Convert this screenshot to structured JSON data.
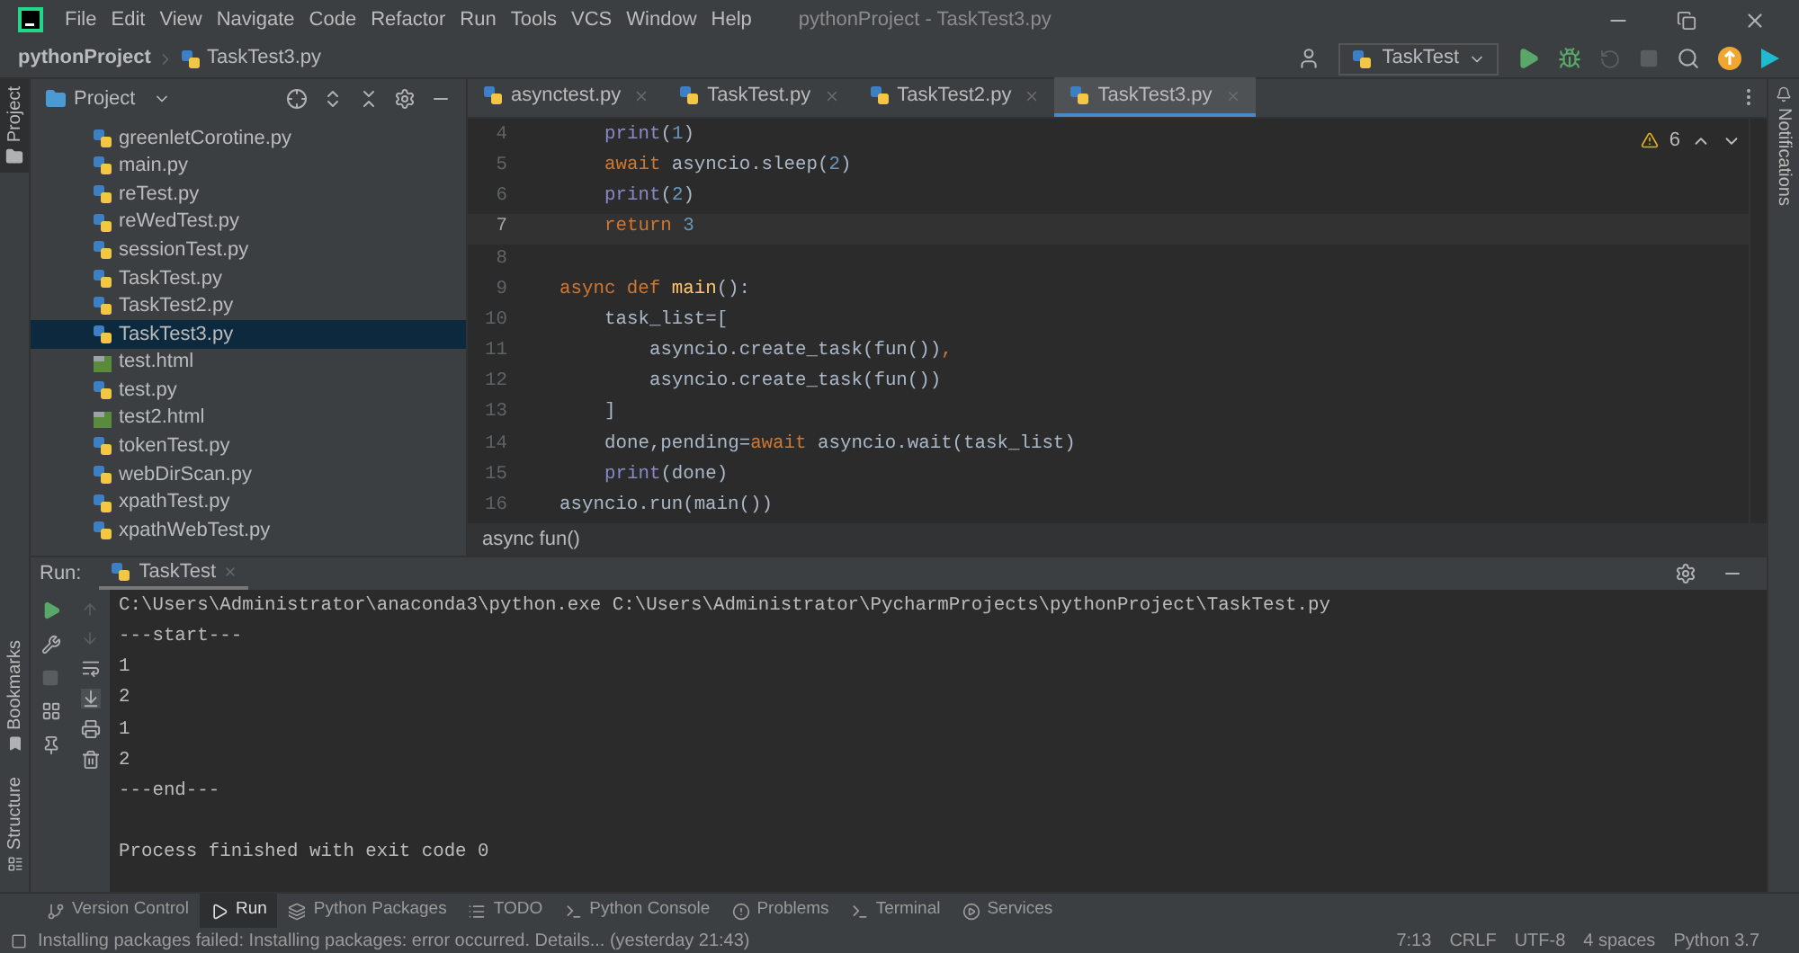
{
  "menu": [
    "File",
    "Edit",
    "View",
    "Navigate",
    "Code",
    "Refactor",
    "Run",
    "Tools",
    "VCS",
    "Window",
    "Help"
  ],
  "window": {
    "title": "pythonProject - TaskTest3.py"
  },
  "breadcrumb": [
    "pythonProject",
    "TaskTest3.py"
  ],
  "run_config": "TaskTest",
  "left_strip": [
    "Project",
    "Bookmarks",
    "Structure"
  ],
  "right_strip": [
    "Notifications"
  ],
  "project_panel": {
    "title": "Project",
    "files": [
      {
        "name": "greenletCorotine.py",
        "kind": "python",
        "selected": false
      },
      {
        "name": "main.py",
        "kind": "python",
        "selected": false
      },
      {
        "name": "reTest.py",
        "kind": "python",
        "selected": false
      },
      {
        "name": "reWedTest.py",
        "kind": "python",
        "selected": false
      },
      {
        "name": "sessionTest.py",
        "kind": "python",
        "selected": false
      },
      {
        "name": "TaskTest.py",
        "kind": "python",
        "selected": false
      },
      {
        "name": "TaskTest2.py",
        "kind": "python",
        "selected": false
      },
      {
        "name": "TaskTest3.py",
        "kind": "python",
        "selected": true
      },
      {
        "name": "test.html",
        "kind": "html",
        "selected": false
      },
      {
        "name": "test.py",
        "kind": "python",
        "selected": false
      },
      {
        "name": "test2.html",
        "kind": "html",
        "selected": false
      },
      {
        "name": "tokenTest.py",
        "kind": "python",
        "selected": false
      },
      {
        "name": "webDirScan.py",
        "kind": "python",
        "selected": false
      },
      {
        "name": "xpathTest.py",
        "kind": "python",
        "selected": false
      },
      {
        "name": "xpathWebTest.py",
        "kind": "python",
        "selected": false
      }
    ]
  },
  "editor_tabs": [
    {
      "label": "asynctest.py",
      "selected": false
    },
    {
      "label": "TaskTest.py",
      "selected": false
    },
    {
      "label": "TaskTest2.py",
      "selected": false
    },
    {
      "label": "TaskTest3.py",
      "selected": true
    }
  ],
  "warnings": "6",
  "code": [
    {
      "number": "4",
      "current": false,
      "kind": "body",
      "tokens": [
        {
          "kind": "builtin",
          "text": "print"
        },
        {
          "kind": "plain",
          "text": "("
        },
        {
          "kind": "number",
          "text": "1"
        },
        {
          "kind": "plain",
          "text": ")"
        }
      ]
    },
    {
      "number": "5",
      "current": false,
      "kind": "body",
      "tokens": [
        {
          "kind": "keyword",
          "text": "await"
        },
        {
          "kind": "plain",
          "text": " asyncio.sleep("
        },
        {
          "kind": "number",
          "text": "2"
        },
        {
          "kind": "plain",
          "text": ")"
        }
      ]
    },
    {
      "number": "6",
      "current": false,
      "kind": "body",
      "tokens": [
        {
          "kind": "builtin",
          "text": "print"
        },
        {
          "kind": "plain",
          "text": "("
        },
        {
          "kind": "number",
          "text": "2"
        },
        {
          "kind": "plain",
          "text": ")"
        }
      ]
    },
    {
      "number": "7",
      "current": true,
      "kind": "body",
      "tokens": [
        {
          "kind": "keyword",
          "text": "return"
        },
        {
          "kind": "number",
          "text": " 3"
        }
      ]
    },
    {
      "number": "8",
      "current": false
    },
    {
      "number": "9",
      "current": false,
      "kind": "top",
      "tokens": [
        {
          "kind": "keyword",
          "text": "async def"
        },
        {
          "kind": "function",
          "text": " main"
        },
        {
          "kind": "plain",
          "text": "():"
        }
      ]
    },
    {
      "number": "10",
      "current": false,
      "kind": "body",
      "tokens": [
        {
          "kind": "plain",
          "text": "task_list=["
        }
      ]
    },
    {
      "number": "11",
      "current": false,
      "kind": "nested",
      "tokens": [
        {
          "kind": "plain",
          "text": "asyncio.create_task(fun())"
        },
        {
          "kind": "keyword",
          "text": ","
        }
      ]
    },
    {
      "number": "12",
      "current": false,
      "kind": "nested",
      "tokens": [
        {
          "kind": "plain",
          "text": "asyncio.create_task(fun())"
        }
      ]
    },
    {
      "number": "13",
      "current": false,
      "kind": "body",
      "tokens": [
        {
          "kind": "plain",
          "text": "]"
        }
      ]
    },
    {
      "number": "14",
      "current": false,
      "kind": "body",
      "tokens": [
        {
          "kind": "plain",
          "text": "done,pending="
        },
        {
          "kind": "keyword",
          "text": "await"
        },
        {
          "kind": "plain",
          "text": " asyncio.wait(task_list)"
        }
      ]
    },
    {
      "number": "15",
      "current": false,
      "kind": "body",
      "tokens": [
        {
          "kind": "builtin",
          "text": "print"
        },
        {
          "kind": "plain",
          "text": "(done)"
        }
      ]
    },
    {
      "number": "16",
      "current": false,
      "kind": "top",
      "tokens": [
        {
          "kind": "plain",
          "text": "asyncio.run(main())"
        }
      ]
    }
  ],
  "editor_breadcrumb": "async fun()",
  "run_panel": {
    "label": "Run:",
    "tab": "TaskTest",
    "output": [
      {
        "kind": "line",
        "text": "C:\\Users\\Administrator\\anaconda3\\python.exe C:\\Users\\Administrator\\PycharmProjects\\pythonProject\\TaskTest.py"
      },
      {
        "kind": "line",
        "text": "---start---"
      },
      {
        "kind": "line",
        "text": "1"
      },
      {
        "kind": "line",
        "text": "2"
      },
      {
        "kind": "line",
        "text": "1"
      },
      {
        "kind": "line",
        "text": "2"
      },
      {
        "kind": "line",
        "text": "---end---"
      },
      {
        "kind": "exit",
        "text": "Process finished with exit code 0"
      }
    ]
  },
  "bottom_tabs": [
    {
      "label": "Version Control",
      "selected": false
    },
    {
      "label": "Run",
      "selected": true
    },
    {
      "label": "Python Packages",
      "selected": false
    },
    {
      "label": "TODO",
      "selected": false
    },
    {
      "label": "Python Console",
      "selected": false
    },
    {
      "label": "Problems",
      "selected": false
    },
    {
      "label": "Terminal",
      "selected": false
    },
    {
      "label": "Services",
      "selected": false
    }
  ],
  "status_bar": {
    "message": "Installing packages failed: Installing packages: error occurred. Details... (yesterday 21:43)",
    "items": [
      "7:13",
      "CRLF",
      "UTF-8",
      "4 spaces",
      "Python 3.7"
    ]
  }
}
